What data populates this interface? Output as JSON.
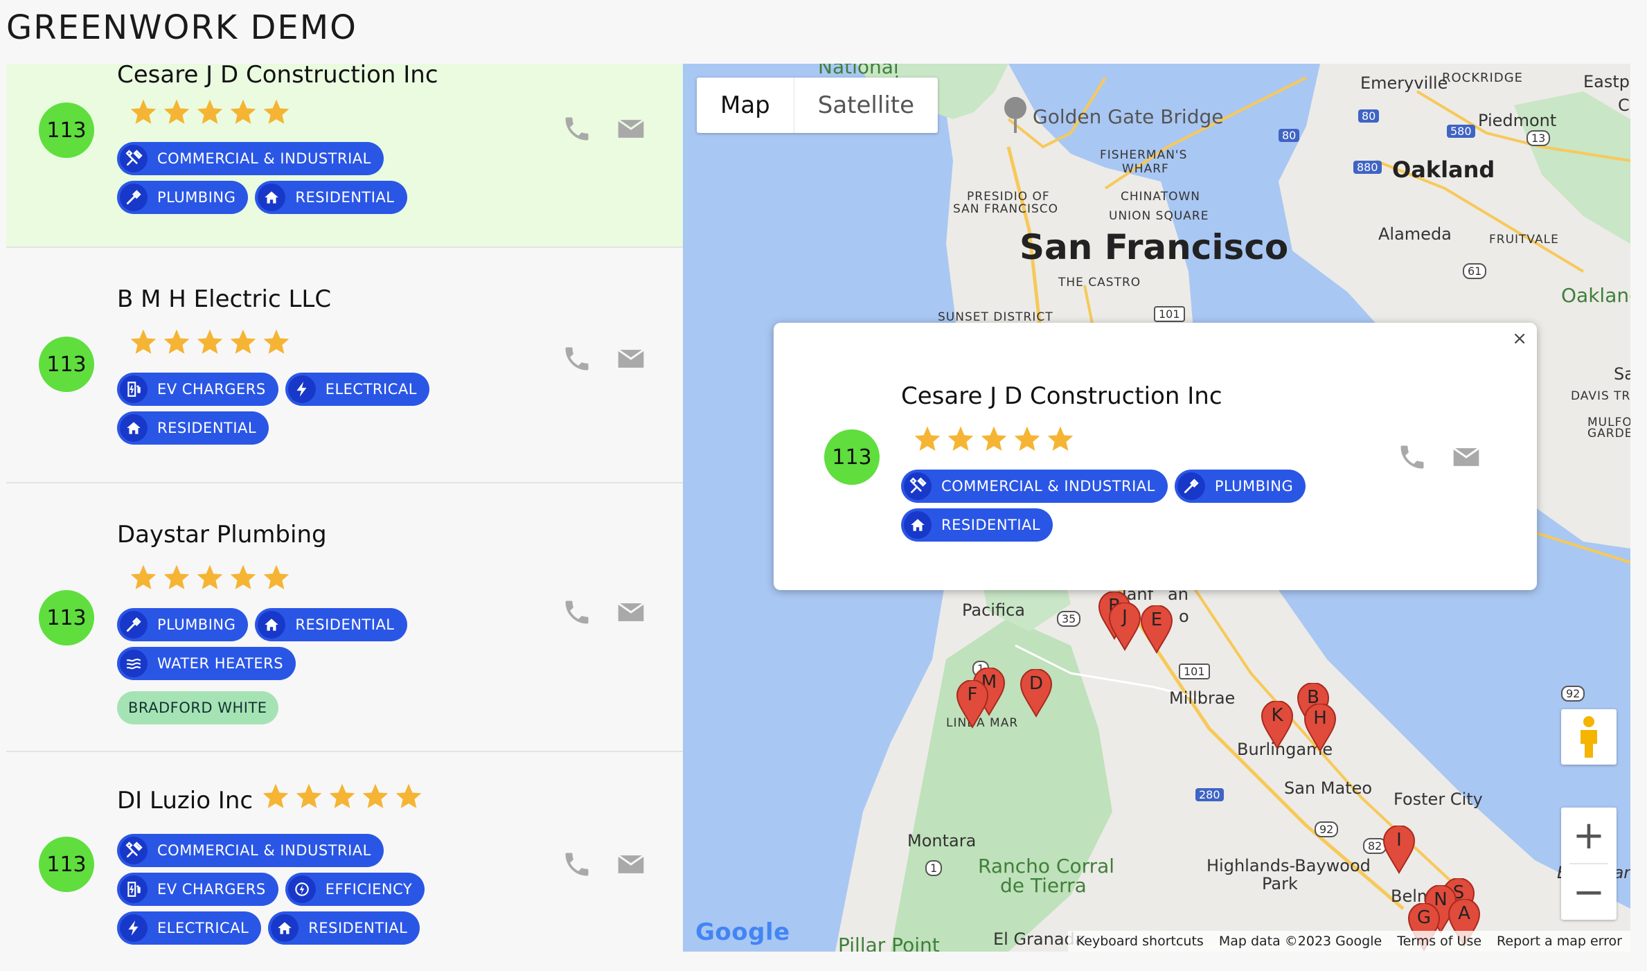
{
  "app": {
    "title": "GREENWORK DEMO"
  },
  "colors": {
    "score": "#5fde3e",
    "tag": "#2a56e6",
    "tag_icon": "#1838c9",
    "brand_tag": "#a6e3b4",
    "star": "#f5b433",
    "pin": "#e14b3b",
    "selected": "#eafbe0"
  },
  "contractors": [
    {
      "name": "Cesare J D Construction Inc",
      "score": "113",
      "rating": 5,
      "tags": [
        {
          "label": "COMMERCIAL & INDUSTRIAL",
          "icon": "tools-icon"
        },
        {
          "label": "PLUMBING",
          "icon": "pipe-wrench-icon"
        },
        {
          "label": "RESIDENTIAL",
          "icon": "house-icon"
        }
      ]
    },
    {
      "name": "B M H Electric LLC",
      "score": "113",
      "rating": 5,
      "tags": [
        {
          "label": "EV CHARGERS",
          "icon": "ev-charger-icon"
        },
        {
          "label": "ELECTRICAL",
          "icon": "lightning-icon"
        },
        {
          "label": "RESIDENTIAL",
          "icon": "house-icon"
        }
      ]
    },
    {
      "name": "Daystar Plumbing",
      "score": "113",
      "rating": 5,
      "tags": [
        {
          "label": "PLUMBING",
          "icon": "pipe-wrench-icon"
        },
        {
          "label": "RESIDENTIAL",
          "icon": "house-icon"
        },
        {
          "label": "WATER HEATERS",
          "icon": "waves-icon"
        }
      ],
      "brands": [
        "BRADFORD WHITE"
      ]
    },
    {
      "name": "DI Luzio Inc",
      "score": "113",
      "rating": 5,
      "tags": [
        {
          "label": "COMMERCIAL & INDUSTRIAL",
          "icon": "tools-icon"
        },
        {
          "label": "EV CHARGERS",
          "icon": "ev-charger-icon"
        },
        {
          "label": "EFFICIENCY",
          "icon": "efficiency-icon"
        },
        {
          "label": "ELECTRICAL",
          "icon": "lightning-icon"
        },
        {
          "label": "RESIDENTIAL",
          "icon": "house-icon"
        }
      ]
    }
  ],
  "map": {
    "toggle": {
      "map": "Map",
      "satellite": "Satellite"
    },
    "labels": {
      "national": "National",
      "ion": "ion",
      "golden_gate": "Golden Gate Bridge",
      "emeryville": "Emeryville",
      "rockridge": "ROCKRIDGE",
      "eastpo": "Eastpo",
      "c": "C",
      "piedmont": "Piedmont",
      "fishermans_wharf_1": "FISHERMAN'S",
      "fishermans_wharf_2": "WHARF",
      "oakland": "Oakland",
      "presidio_1": "PRESIDIO OF",
      "presidio_2": "SAN FRANCISCO",
      "chinatown": "CHINATOWN",
      "union_square": "UNION SQUARE",
      "alameda": "Alameda",
      "fruitvale": "FRUITVALE",
      "san_francisco": "San Francisco",
      "the_castro": "THE CASTRO",
      "oakland_2": "Oakland",
      "sunset": "SUNSET DISTRICT",
      "sa": "Sa",
      "davis": "DAVIS TR",
      "mulford_1": "MULFO",
      "mulford_2": "GARDE",
      "tanf_1": "Tanf",
      "tanf_2": "an",
      "o": "o",
      "pacifica": "Pacifica",
      "millbrae": "Millbrae",
      "linda_mar": "LINDA MAR",
      "burlingame": "Burlingame",
      "san_mateo": "San Mateo",
      "foster_city": "Foster City",
      "montara": "Montara",
      "rancho_1": "Rancho Corral",
      "rancho_2": "de Tierra",
      "highlands_1": "Highlands-Baywood",
      "highlands_2": "Park",
      "belmo": "Belmo",
      "bair": "Bair Islan",
      "el_granada": "El Granada",
      "pillar_point": "Pillar Point"
    },
    "shields": {
      "s80a": "80",
      "s80b": "80",
      "s580": "580",
      "s880": "880",
      "s13": "13",
      "s61": "61",
      "s101a": "101",
      "s35": "35",
      "s101b": "101",
      "s1a": "1",
      "s92a": "92",
      "s280": "280",
      "s92b": "92",
      "s82": "82",
      "s1b": "1"
    },
    "pins": [
      "B",
      "J",
      "E",
      "M",
      "F",
      "D",
      "B",
      "K",
      "H",
      "I",
      "S",
      "N",
      "G",
      "A"
    ],
    "google_logo": "Google",
    "footer": {
      "shortcuts": "Keyboard shortcuts",
      "data": "Map data ©2023 Google",
      "terms": "Terms of Use",
      "report": "Report a map error"
    },
    "popup": {
      "close": "×"
    },
    "zoom": {
      "in": "+",
      "out": "−"
    }
  }
}
